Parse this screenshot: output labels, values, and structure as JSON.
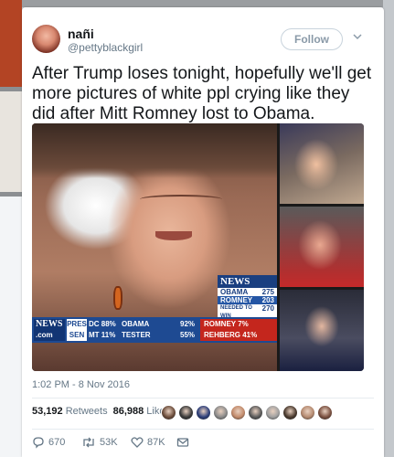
{
  "tweet": {
    "display_name": "nañi",
    "handle": "@pettyblackgirl",
    "follow_label": "Follow",
    "text": "After Trump loses tonight, hopefully we'll get more pictures of white ppl crying like they did after Mitt Romney lost to Obama.",
    "timestamp": "1:02 PM - 8 Nov 2016"
  },
  "tv_graphic": {
    "mini": {
      "logo": "NEWS",
      "rows": [
        {
          "label": "OBAMA",
          "value": "275"
        },
        {
          "label": "ROMNEY",
          "value": "203"
        },
        {
          "label": "NEEDED TO WIN",
          "value": "270"
        }
      ]
    },
    "ticker": {
      "logo": "NEWS",
      "logo_sub": ".com",
      "tags": [
        "PRES",
        "SEN"
      ],
      "states": [
        "DC 88%",
        "MT 11%"
      ],
      "candidates": [
        "OBAMA",
        "TESTER"
      ],
      "pcts": [
        "92%",
        "55%"
      ],
      "opponents": [
        "ROMNEY 7%",
        "REHBERG 41%"
      ]
    }
  },
  "stats": {
    "retweets_count": "53,192",
    "retweets_label": "Retweets",
    "likes_count": "86,988",
    "likes_label": "Likes"
  },
  "likers": [
    "#6b4c3a",
    "#3a3a3a",
    "#2c3e7a",
    "#8a8a8a",
    "#c28a6a",
    "#5a5a5a",
    "#a0a0a0",
    "#4a3a2e",
    "#b58a70",
    "#7a5040"
  ],
  "actions": {
    "reply_count": "670",
    "retweet_count": "53K",
    "like_count": "87K"
  },
  "colors": {
    "text_primary": "#14171a",
    "text_secondary": "#657786",
    "border": "#e6ecf0",
    "news_blue": "#1e4a92",
    "news_red": "#c4261d"
  }
}
